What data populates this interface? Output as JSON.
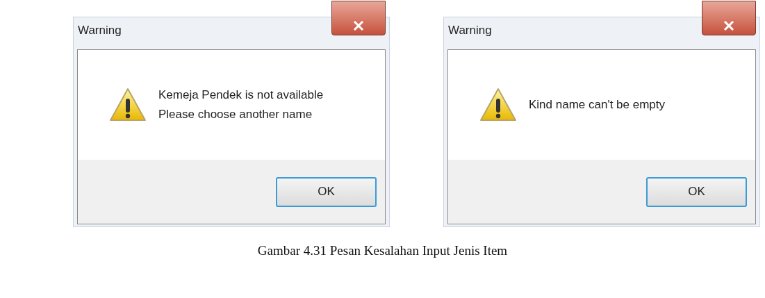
{
  "dialogs": [
    {
      "title": "Warning",
      "message_lines": [
        "Kemeja Pendek is not available",
        "Please choose another name"
      ],
      "button": "OK"
    },
    {
      "title": "Warning",
      "message_lines": [
        "Kind name can't be empty"
      ],
      "button": "OK"
    }
  ],
  "caption": "Gambar 4.31 Pesan Kesalahan Input Jenis Item"
}
